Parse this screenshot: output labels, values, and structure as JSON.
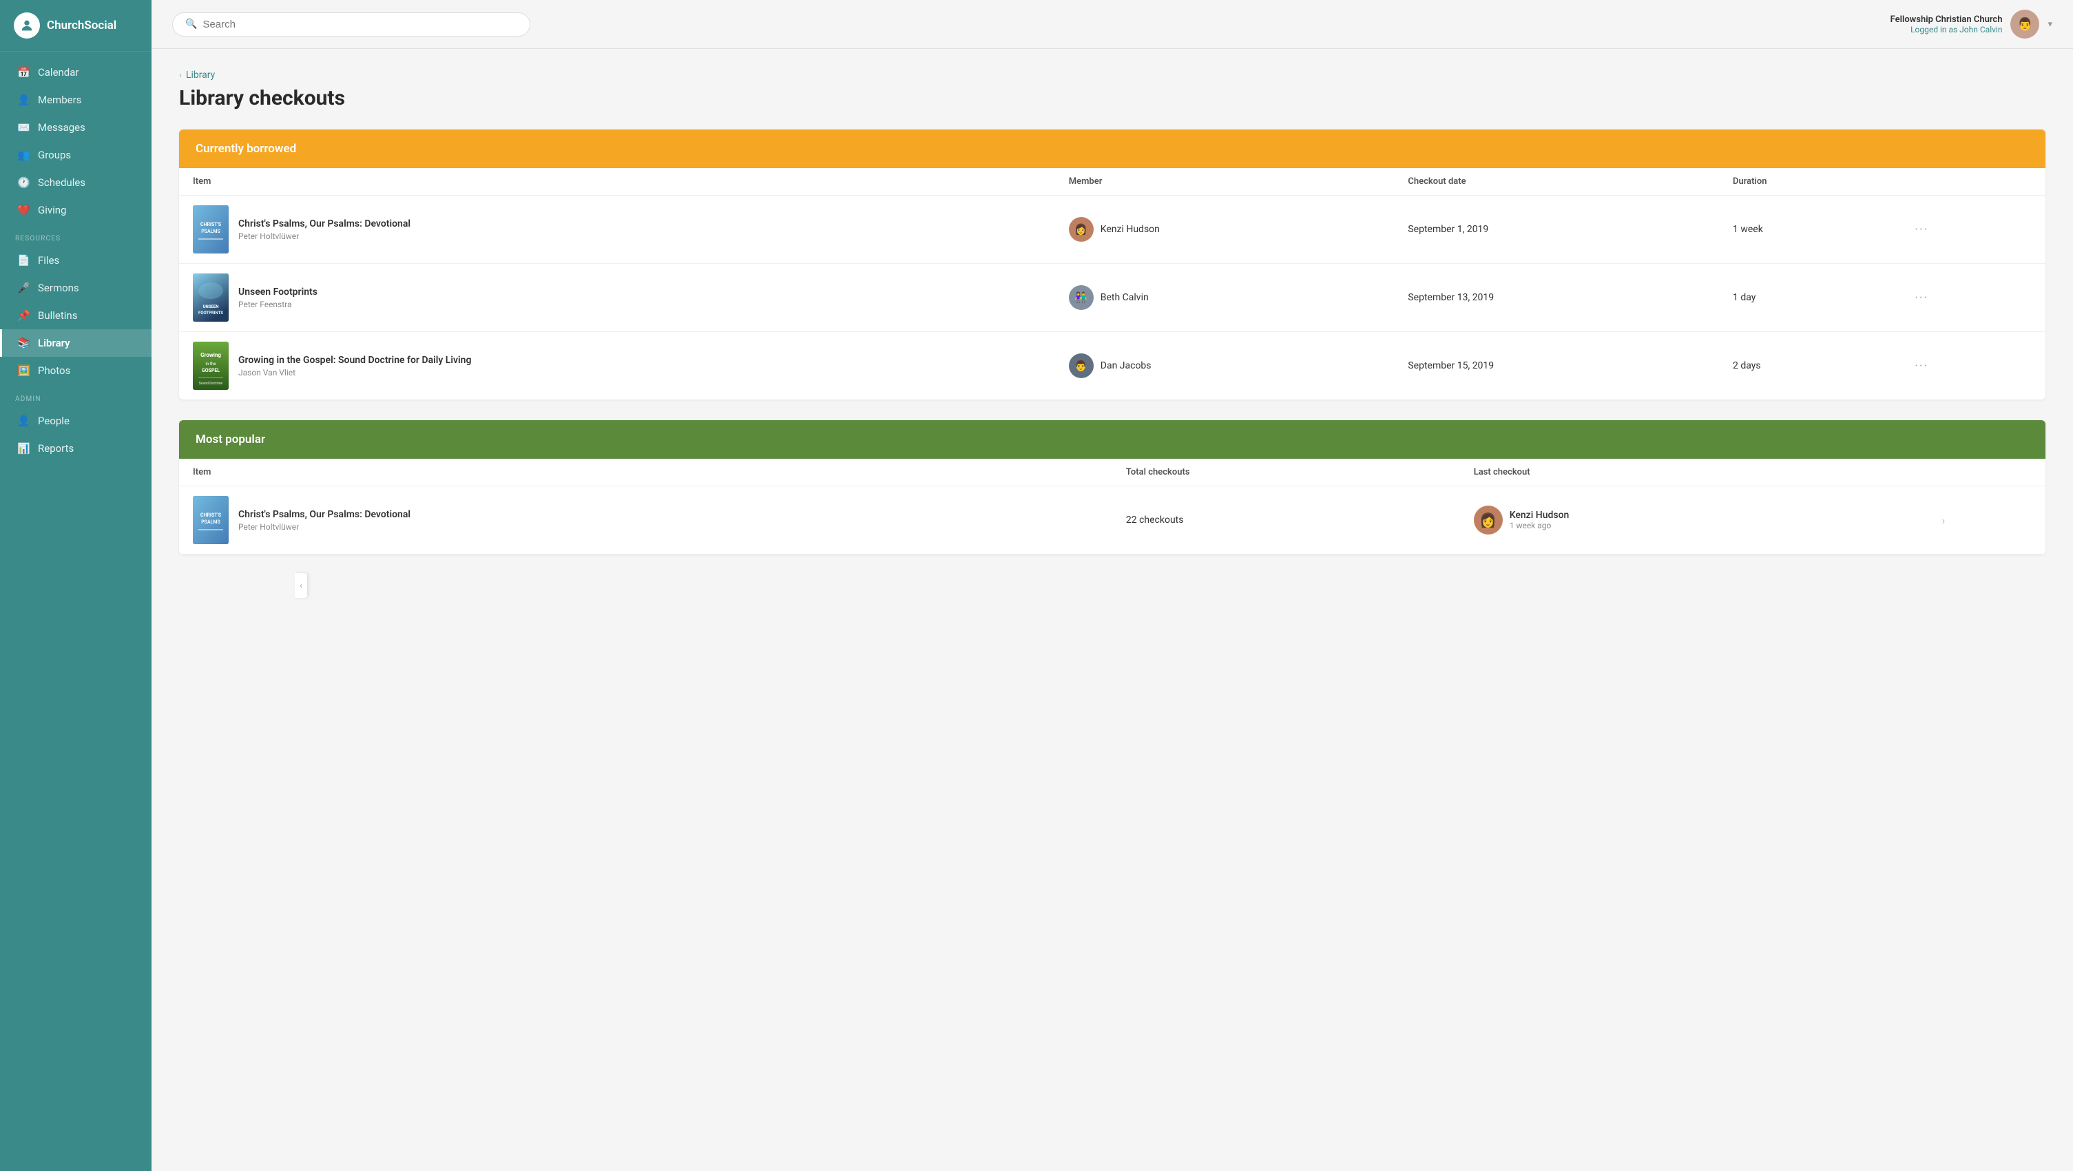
{
  "app": {
    "name": "ChurchSocial"
  },
  "header": {
    "search_placeholder": "Search",
    "church_name": "Fellowship Christian Church",
    "logged_in_label": "Logged in as John Calvin"
  },
  "sidebar": {
    "main_items": [
      {
        "id": "calendar",
        "label": "Calendar",
        "icon": "📅"
      },
      {
        "id": "members",
        "label": "Members",
        "icon": "👤"
      },
      {
        "id": "messages",
        "label": "Messages",
        "icon": "✉️"
      },
      {
        "id": "groups",
        "label": "Groups",
        "icon": "👥"
      },
      {
        "id": "schedules",
        "label": "Schedules",
        "icon": "🕐"
      },
      {
        "id": "giving",
        "label": "Giving",
        "icon": "❤️"
      }
    ],
    "resources_label": "RESOURCES",
    "resource_items": [
      {
        "id": "files",
        "label": "Files",
        "icon": "📄"
      },
      {
        "id": "sermons",
        "label": "Sermons",
        "icon": "🎤"
      },
      {
        "id": "bulletins",
        "label": "Bulletins",
        "icon": "📌"
      },
      {
        "id": "library",
        "label": "Library",
        "icon": "📚",
        "active": true
      },
      {
        "id": "photos",
        "label": "Photos",
        "icon": "🖼️"
      }
    ],
    "admin_label": "ADMIN",
    "admin_items": [
      {
        "id": "people",
        "label": "People",
        "icon": "👤"
      },
      {
        "id": "reports",
        "label": "Reports",
        "icon": "📊"
      }
    ]
  },
  "breadcrumb": {
    "parent": "Library",
    "current": "Library checkouts"
  },
  "page_title": "Library checkouts",
  "currently_borrowed": {
    "section_title": "Currently borrowed",
    "columns": [
      "Item",
      "Member",
      "Checkout date",
      "Duration"
    ],
    "rows": [
      {
        "title": "Christ's Psalms, Our Psalms: Devotional",
        "author": "Peter Holtvlüwer",
        "member": "Kenzi Hudson",
        "checkout_date": "September 1, 2019",
        "duration": "1 week",
        "cover_class": "book-cover-1",
        "avatar_class": "avatar-1"
      },
      {
        "title": "Unseen Footprints",
        "author": "Peter Feenstra",
        "member": "Beth Calvin",
        "checkout_date": "September 13, 2019",
        "duration": "1 day",
        "cover_class": "book-cover-2",
        "avatar_class": "avatar-2"
      },
      {
        "title": "Growing in the Gospel: Sound Doctrine for Daily Living",
        "author": "Jason Van Vliet",
        "member": "Dan Jacobs",
        "checkout_date": "September 15, 2019",
        "duration": "2 days",
        "cover_class": "book-cover-3",
        "avatar_class": "avatar-3"
      }
    ]
  },
  "most_popular": {
    "section_title": "Most popular",
    "columns": [
      "Item",
      "Total checkouts",
      "Last checkout"
    ],
    "rows": [
      {
        "title": "Christ's Psalms, Our Psalms: Devotional",
        "author": "Peter Holtvlüwer",
        "total_checkouts": "22 checkouts",
        "last_checkout_member": "Kenzi Hudson",
        "last_checkout_time": "1 week ago",
        "cover_class": "book-cover-1",
        "avatar_class": "avatar-1"
      }
    ]
  }
}
